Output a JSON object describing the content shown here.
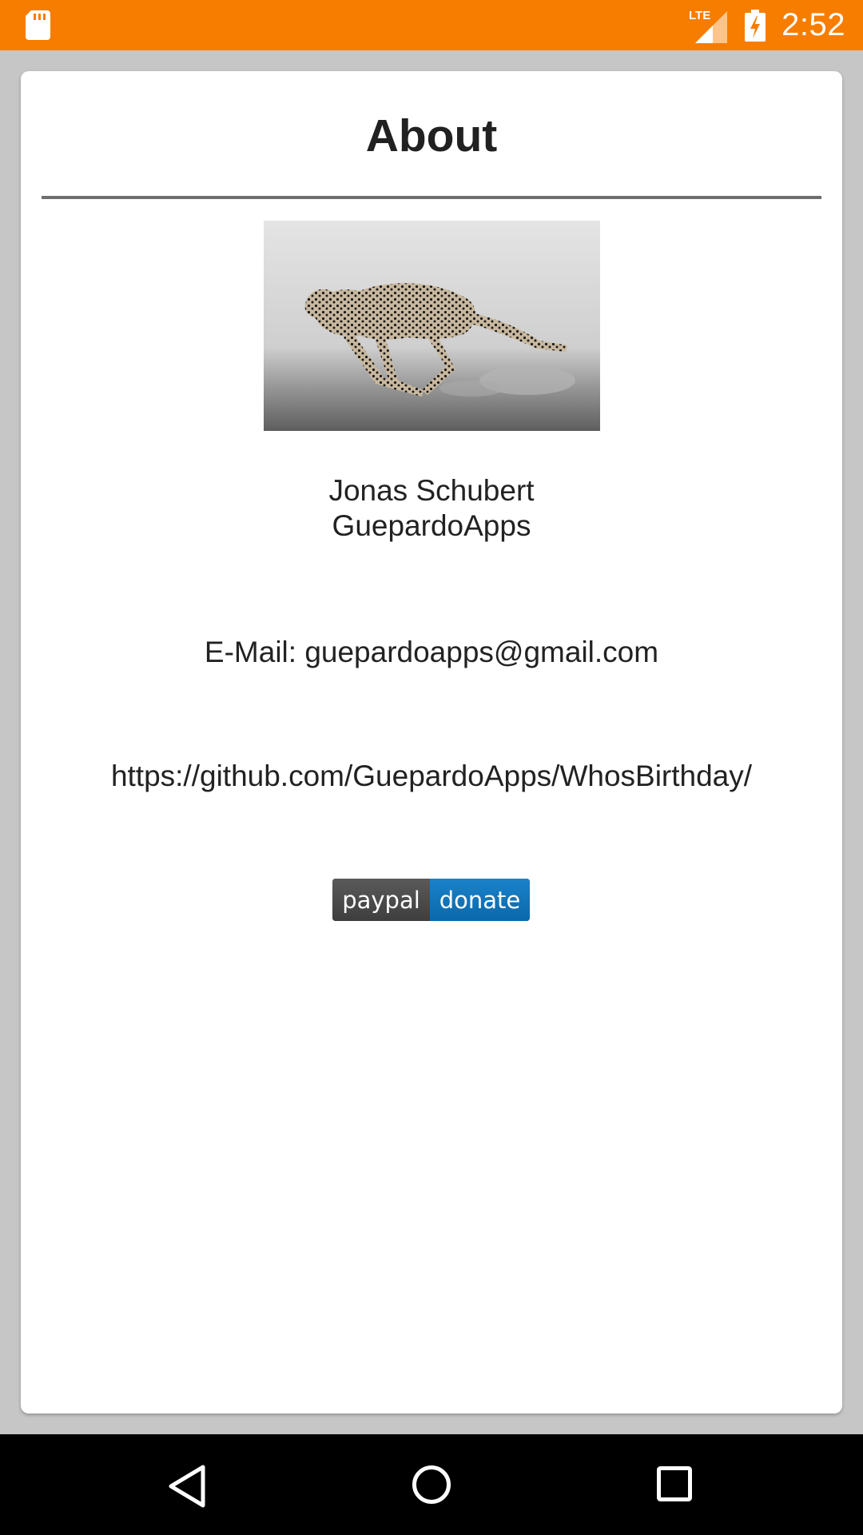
{
  "status_bar": {
    "time": "2:52",
    "network": "LTE",
    "icons": [
      "sd-card-icon",
      "lte-signal-icon",
      "battery-charging-icon"
    ]
  },
  "dialog": {
    "title": "About",
    "author_name": "Jonas Schubert",
    "company": "GuepardoApps",
    "email": "E-Mail: guepardoapps@gmail.com",
    "github_url": "https://github.com/GuepardoApps/WhosBirthday/",
    "donate": {
      "left_label": "paypal",
      "right_label": "donate"
    }
  },
  "nav_bar": {
    "icons": [
      "back-icon",
      "home-icon",
      "recents-icon"
    ]
  },
  "colors": {
    "status_bar": "#f77d00",
    "background": "#c6c6c6",
    "dialog": "#ffffff",
    "paypal_gray": "#4a4a4a",
    "paypal_blue": "#1478bd"
  }
}
